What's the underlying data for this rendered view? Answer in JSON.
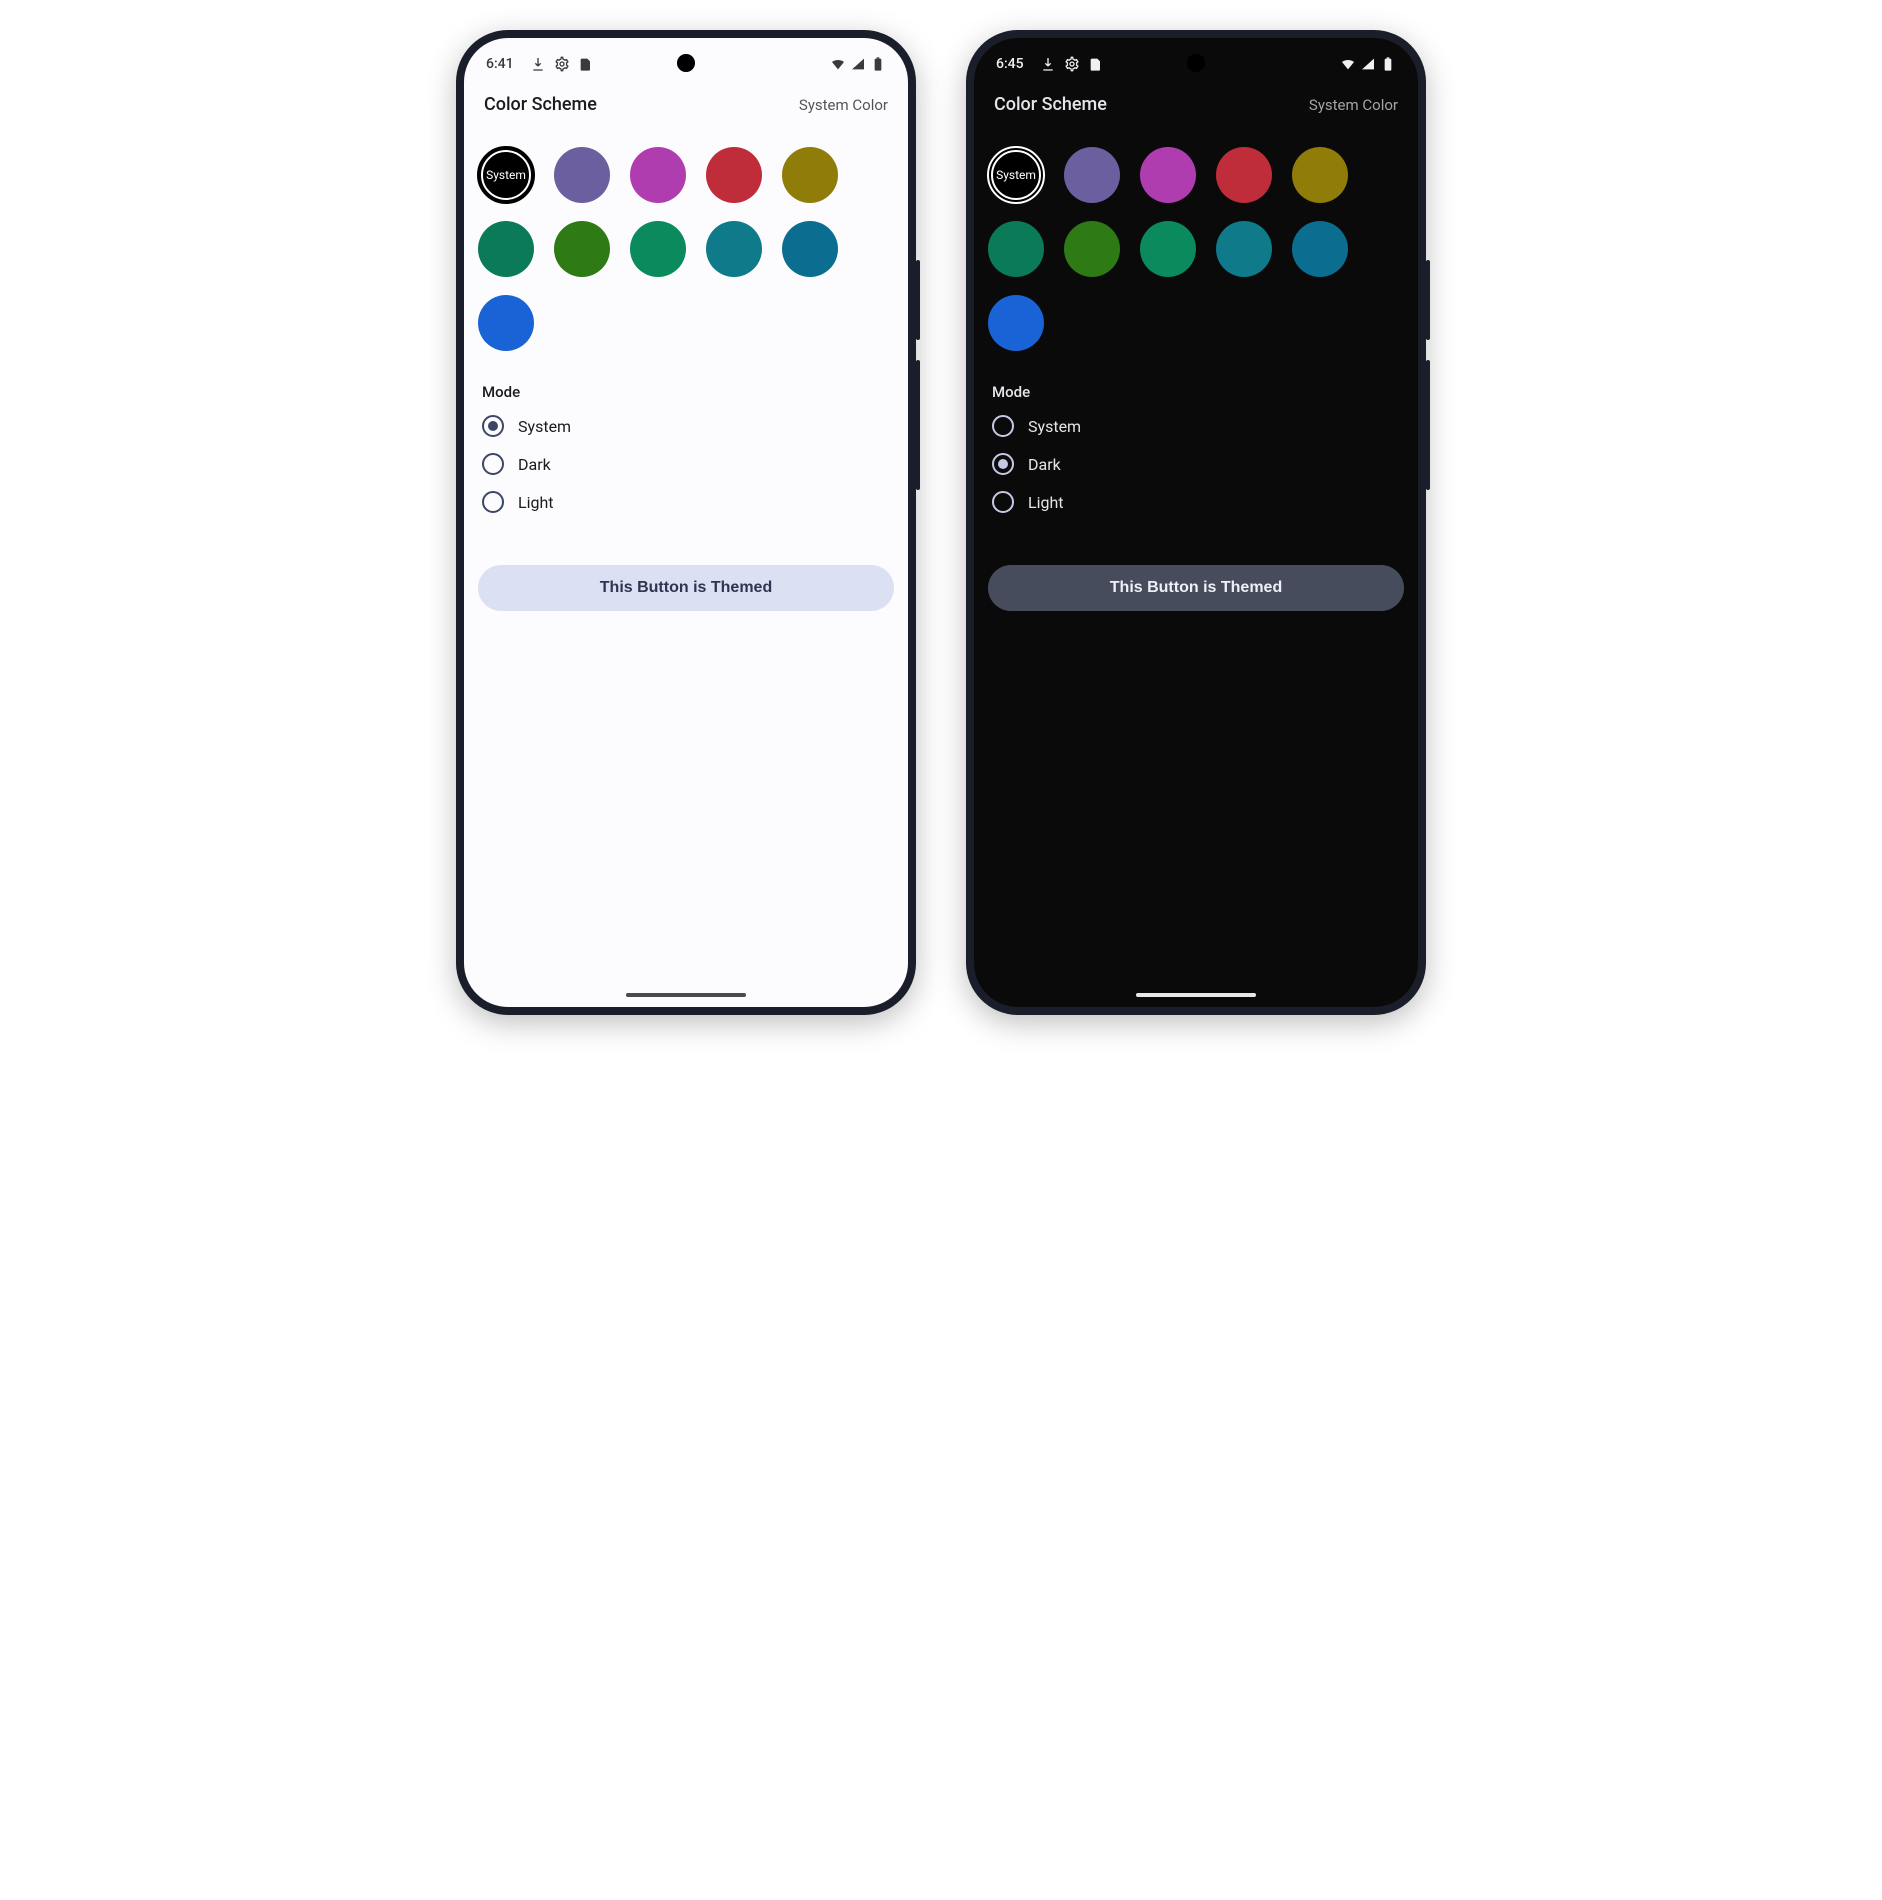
{
  "phones": {
    "light": {
      "status": {
        "time": "6:41"
      },
      "header": {
        "title": "Color Scheme",
        "action": "System Color"
      },
      "swatches": {
        "system_label": "System",
        "colors": [
          "#6b5fa0",
          "#b03db0",
          "#c02d3a",
          "#8f7c09",
          "#0b7a58",
          "#2e7a14",
          "#0b8a5e",
          "#0e7a8a",
          "#0b6d8f",
          "#1a63d6"
        ]
      },
      "mode": {
        "label": "Mode",
        "options": [
          "System",
          "Dark",
          "Light"
        ],
        "selected": "System"
      },
      "button": {
        "label": "This Button is Themed"
      }
    },
    "dark": {
      "status": {
        "time": "6:45"
      },
      "header": {
        "title": "Color Scheme",
        "action": "System Color"
      },
      "swatches": {
        "system_label": "System",
        "colors": [
          "#6b5fa0",
          "#b03db0",
          "#c02d3a",
          "#8f7c09",
          "#0b7a58",
          "#2e7a14",
          "#0b8a5e",
          "#0e7a8a",
          "#0b6d8f",
          "#1a63d6"
        ]
      },
      "mode": {
        "label": "Mode",
        "options": [
          "System",
          "Dark",
          "Light"
        ],
        "selected": "Dark"
      },
      "button": {
        "label": "This Button is Themed"
      }
    }
  }
}
